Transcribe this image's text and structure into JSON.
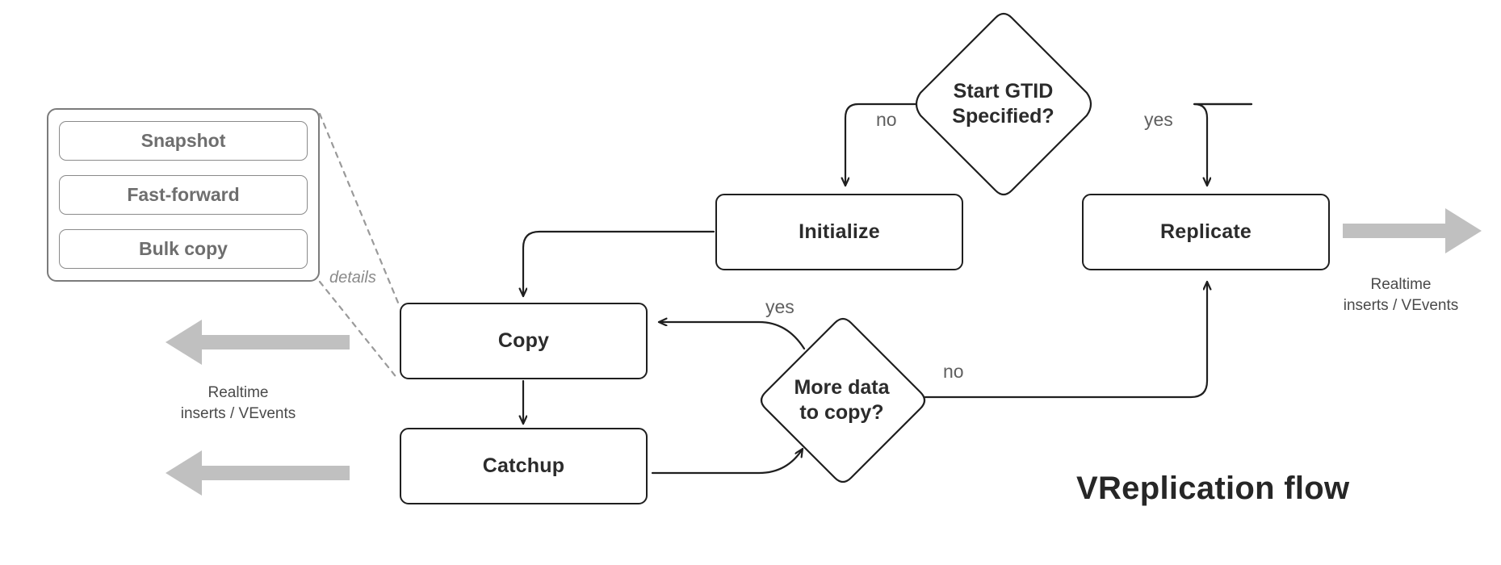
{
  "title": "VReplication flow",
  "nodes": {
    "initialize": "Initialize",
    "replicate": "Replicate",
    "copy": "Copy",
    "catchup": "Catchup"
  },
  "decisions": {
    "start_gtid": "Start GTID\nSpecified?",
    "more_data": "More data\nto copy?"
  },
  "group": {
    "details_label": "details",
    "items": [
      {
        "label": "Snapshot"
      },
      {
        "label": "Fast-forward"
      },
      {
        "label": "Bulk copy"
      }
    ]
  },
  "edge_labels": {
    "gtid_no": "no",
    "gtid_yes": "yes",
    "more_yes": "yes",
    "more_no": "no"
  },
  "captions": {
    "left_copy": "Realtime\ninserts / VEvents",
    "left_catchup": "",
    "right_replicate": "Realtime\ninserts / VEvents"
  },
  "colors": {
    "node_stroke": "#1f1f1f",
    "group_stroke": "#7b7b7b",
    "sub_stroke": "#8a8a8a",
    "gray_arrow": "#c0c0c0",
    "label_text": "#5f5f5f",
    "title_text": "#262626",
    "background": "#ffffff"
  }
}
